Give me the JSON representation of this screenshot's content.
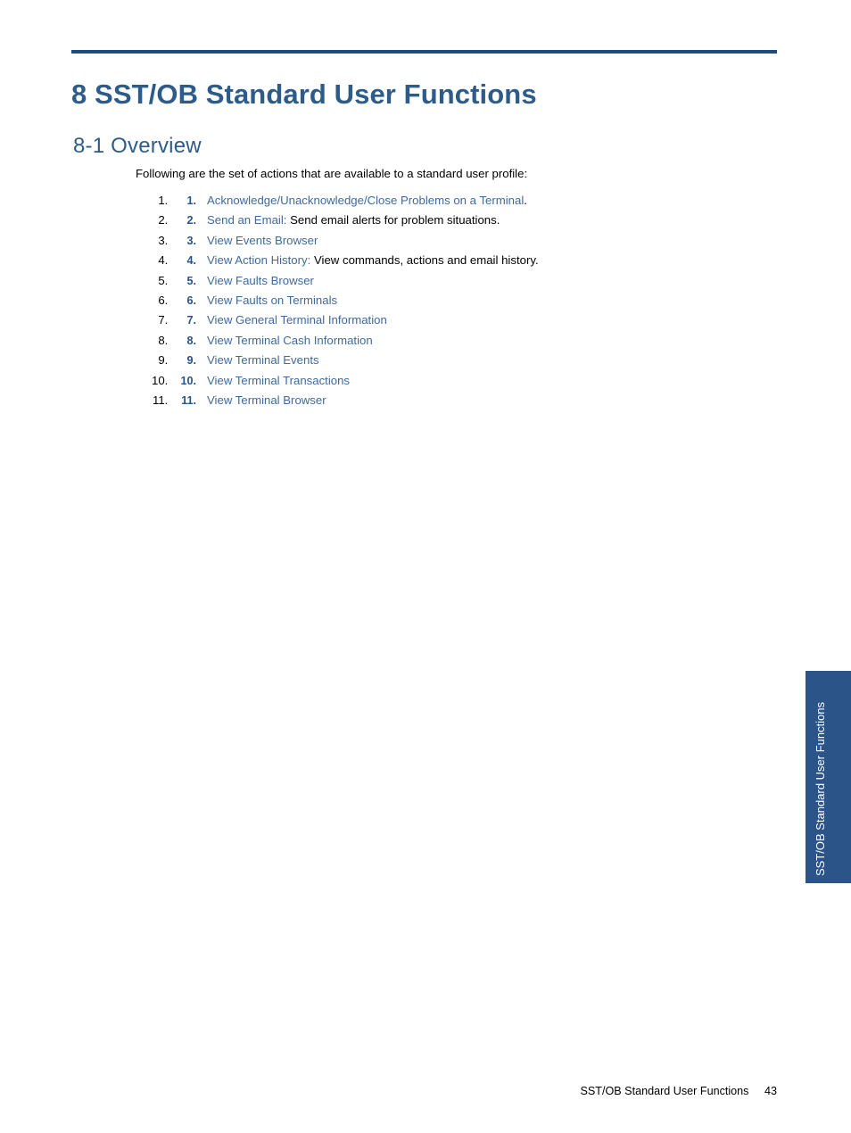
{
  "colors": {
    "rule": "#1f4b82",
    "heading": "#2e5c8a",
    "link": "#3e6a9e",
    "number": "#25538c",
    "tab_background": "#2b5489",
    "tab_text": "#ffffff",
    "body_text": "#000000"
  },
  "header": {
    "chapter_title": "8 SST/OB Standard User Functions"
  },
  "section": {
    "heading": "8-1 Overview",
    "intro": "Following are the set of actions that are available to a standard user profile:"
  },
  "list": {
    "items": [
      {
        "number": "1.",
        "link": "Acknowledge/Unacknowledge/Close Problems on a Terminal",
        "rest": "."
      },
      {
        "number": "2.",
        "link": "Send an Email:",
        "rest": " Send email alerts for problem situations."
      },
      {
        "number": "3.",
        "link": "View Events Browser",
        "rest": ""
      },
      {
        "number": "4.",
        "link": "View Action History:",
        "rest": " View commands, actions and email history."
      },
      {
        "number": "5.",
        "link": "View Faults Browser",
        "rest": ""
      },
      {
        "number": "6.",
        "link": "View Faults on Terminals",
        "rest": ""
      },
      {
        "number": "7.",
        "link": "View General Terminal Information",
        "rest": ""
      },
      {
        "number": "8.",
        "link": "View Terminal Cash Information",
        "rest": ""
      },
      {
        "number": "9.",
        "link": "View Terminal Events",
        "rest": ""
      },
      {
        "number": "10.",
        "link": "View Terminal Transactions",
        "rest": ""
      },
      {
        "number": "11.",
        "link": "View Terminal Browser",
        "rest": ""
      }
    ]
  },
  "side_tab": {
    "label": "SST/OB Standard User Functions"
  },
  "footer": {
    "title": "SST/OB Standard User Functions",
    "page_number": "43"
  }
}
